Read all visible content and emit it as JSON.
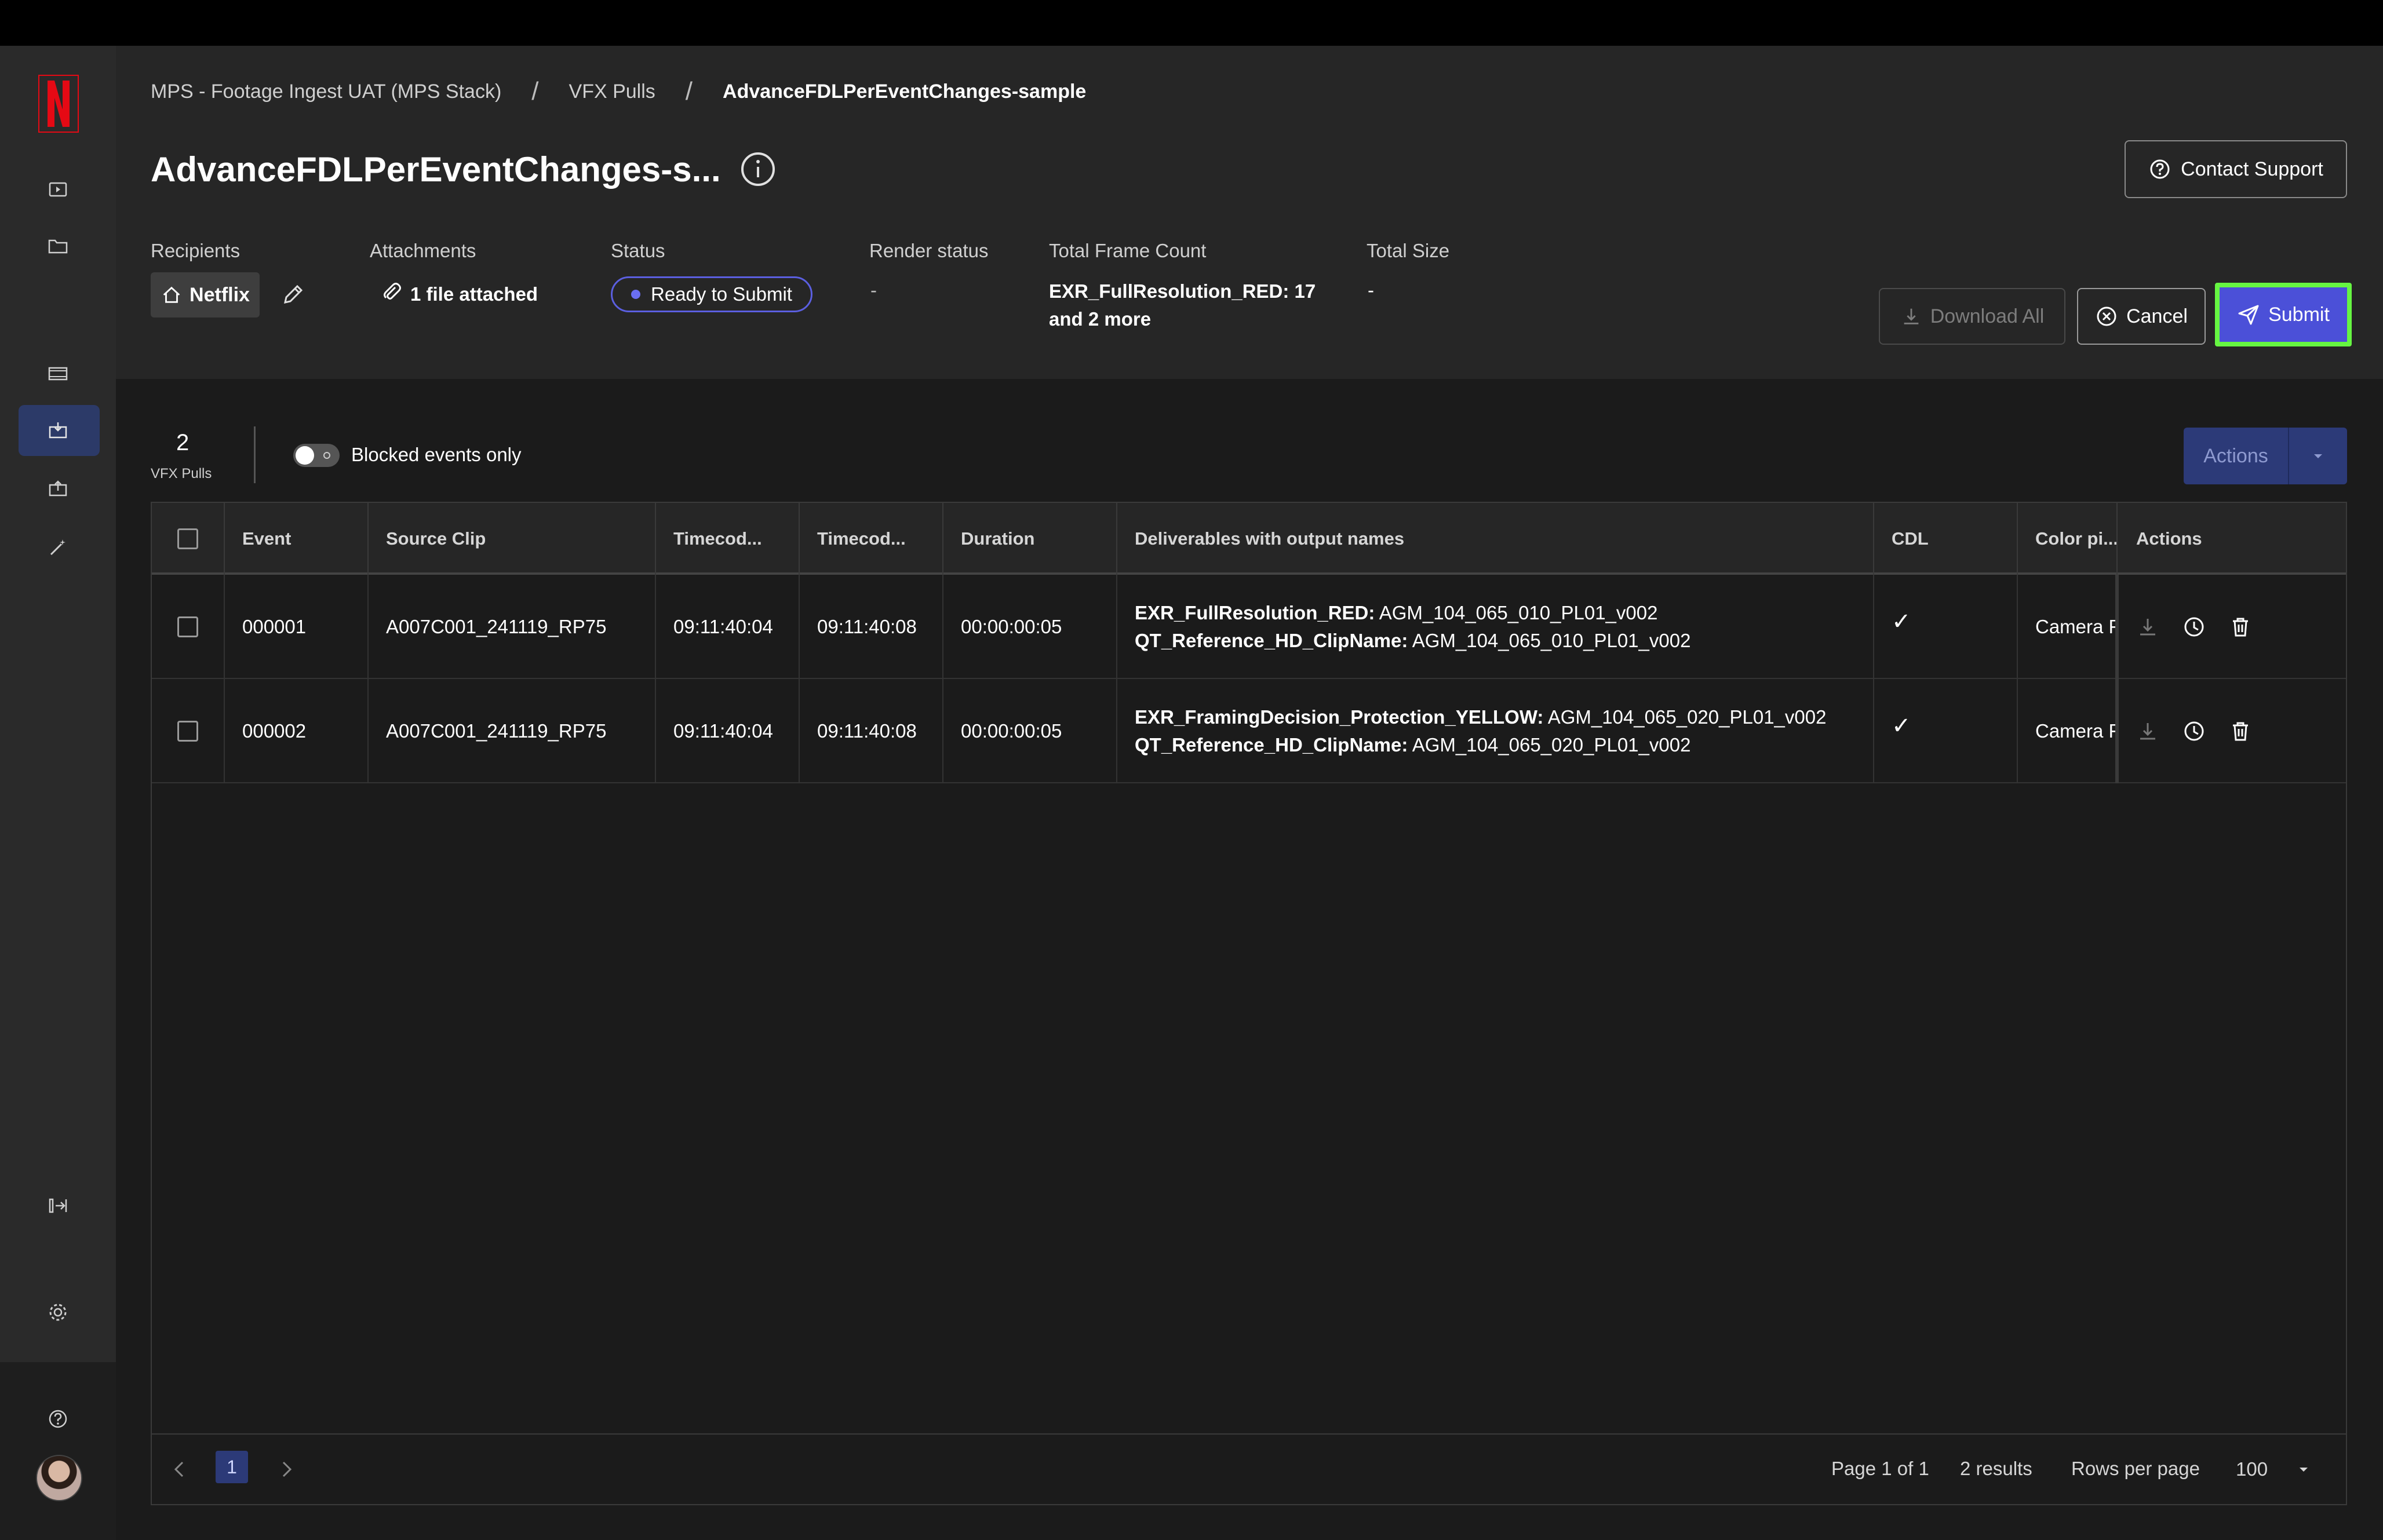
{
  "breadcrumb": {
    "items": [
      "MPS - Footage Ingest UAT (MPS Stack)",
      "VFX Pulls",
      "AdvanceFDLPerEventChanges-sample"
    ],
    "separator": "/"
  },
  "page_title": "AdvanceFDLPerEventChanges-s...",
  "contact_support_label": "Contact Support",
  "meta": {
    "recipients_label": "Recipients",
    "recipient_value": "Netflix",
    "attachments_label": "Attachments",
    "attachments_value": "1 file attached",
    "status_label": "Status",
    "status_value": "Ready to Submit",
    "render_status_label": "Render status",
    "render_status_value": "-",
    "total_frame_count_label": "Total Frame Count",
    "total_frame_count_line1": "EXR_FullResolution_RED: 17",
    "total_frame_count_line2": "and 2 more",
    "total_size_label": "Total Size",
    "total_size_value": "-"
  },
  "buttons": {
    "download_all": "Download All",
    "cancel": "Cancel",
    "submit": "Submit"
  },
  "toolbar": {
    "count": "2",
    "count_label": "VFX Pulls",
    "toggle_label": "Blocked events only",
    "actions_label": "Actions"
  },
  "table": {
    "headers": [
      "Event",
      "Source Clip",
      "Timecod...",
      "Timecod...",
      "Duration",
      "Deliverables with output names",
      "CDL",
      "Color pi...",
      "Actions"
    ],
    "rows": [
      {
        "event": "000001",
        "source_clip": "A007C001_241119_RP75",
        "tc_in": "09:11:40:04",
        "tc_out": "09:11:40:08",
        "duration": "00:00:00:05",
        "deliv1_name": "EXR_FullResolution_RED:",
        "deliv1_value": "AGM_104_065_010_PL01_v002",
        "deliv2_name": "QT_Reference_HD_ClipName:",
        "deliv2_value": "AGM_104_065_010_PL01_v002",
        "cdl": "✓",
        "color_pipeline": "Camera F"
      },
      {
        "event": "000002",
        "source_clip": "A007C001_241119_RP75",
        "tc_in": "09:11:40:04",
        "tc_out": "09:11:40:08",
        "duration": "00:00:00:05",
        "deliv1_name": "EXR_FramingDecision_Protection_YELLOW:",
        "deliv1_value": "AGM_104_065_020_PL01_v002",
        "deliv2_name": "QT_Reference_HD_ClipName:",
        "deliv2_value": "AGM_104_065_020_PL01_v002",
        "cdl": "✓",
        "color_pipeline": "Camera F"
      }
    ]
  },
  "pagination": {
    "current_page": "1",
    "page_info": "Page 1 of 1",
    "results": "2 results",
    "rows_per_page_label": "Rows per page",
    "rows_per_page_value": "100"
  },
  "colors": {
    "accent": "#4b50d8",
    "submit_highlight": "#66f542",
    "brand": "#e50914"
  }
}
